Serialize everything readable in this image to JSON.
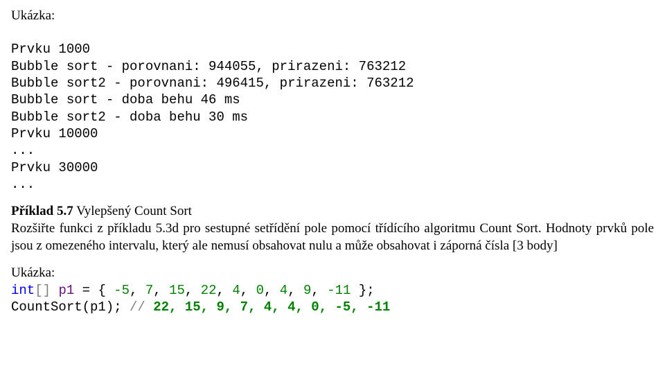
{
  "ukazka_label": "Ukázka:",
  "sample_output": {
    "l1": "Prvku 1000",
    "l2": "Bubble sort - porovnani: 944055, prirazeni: 763212",
    "l3": "Bubble sort2 - porovnani: 496415, prirazeni: 763212",
    "l4": "Bubble sort - doba behu 46 ms",
    "l5": "Bubble sort2 - doba behu 30 ms",
    "l6": "Prvku 10000",
    "l7": "...",
    "l8": "Prvku 30000",
    "l9": "..."
  },
  "priklad": {
    "label": "Příklad 5.7",
    "title_rest": " Vylepšený Count Sort",
    "body_a": "Rozšiřte funkci z příkladu  5.3d pro sestupné setřídění pole pomocí třídícího algoritmu Count Sort. Hodnoty prvků pole jsou z omezeného intervalu, který ale nemusí obsahovat nulu a může obsahovat i záporná čísla [3 body]"
  },
  "ukazka2_label": "Ukázka:",
  "code": {
    "kw_int": "int",
    "p1": "p1",
    "arr_open": "[] ",
    "eq": " = { ",
    "vals": [
      "-5",
      "7",
      "15",
      "22",
      "4",
      "0",
      "4",
      "9",
      "-11"
    ],
    "close": " };",
    "call": "CountSort(p1); ",
    "comment_prefix": "// ",
    "comment_vals": "22, 15, 9, 7, 4, 4, 0, -5, -11"
  }
}
